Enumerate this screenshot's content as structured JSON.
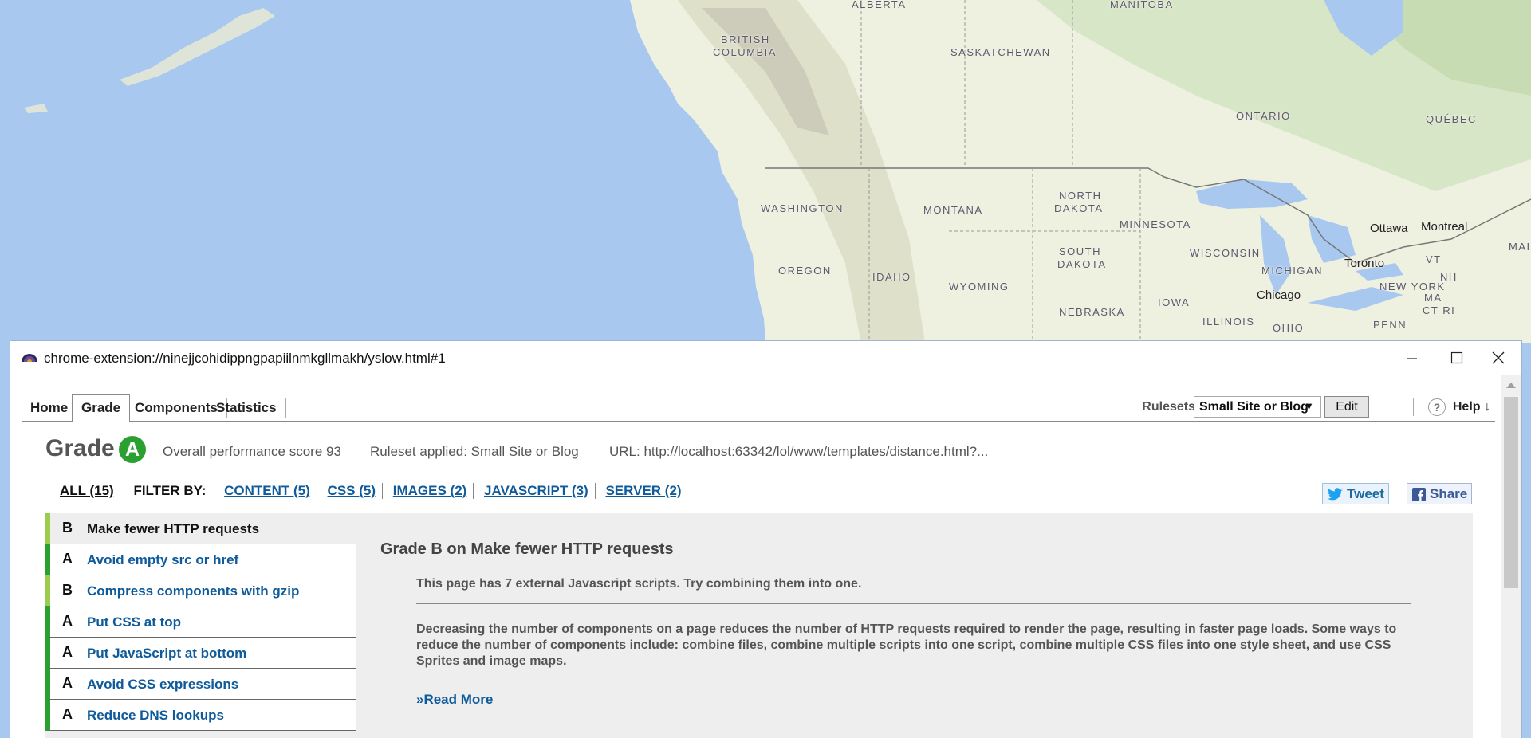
{
  "map": {
    "labels": [
      {
        "text": "ALBERTA",
        "cls": "region"
      },
      {
        "text": "MANITOBA",
        "cls": "region"
      },
      {
        "text": "BRITISH",
        "cls": "region"
      },
      {
        "text": "COLUMBIA",
        "cls": "region"
      },
      {
        "text": "SASKATCHEWAN",
        "cls": "region"
      },
      {
        "text": "ONTARIO",
        "cls": "region"
      },
      {
        "text": "QUÉBEC",
        "cls": "region"
      },
      {
        "text": "WASHINGTON",
        "cls": "region"
      },
      {
        "text": "MONTANA",
        "cls": "region"
      },
      {
        "text": "NORTH",
        "cls": "region"
      },
      {
        "text": "DAKOTA",
        "cls": "region"
      },
      {
        "text": "MINNESOTA",
        "cls": "region"
      },
      {
        "text": "Ottawa",
        "cls": "city"
      },
      {
        "text": "Montreal",
        "cls": "city"
      },
      {
        "text": "MAINE",
        "cls": "region"
      },
      {
        "text": "OREGON",
        "cls": "region"
      },
      {
        "text": "IDAHO",
        "cls": "region"
      },
      {
        "text": "SOUTH",
        "cls": "region"
      },
      {
        "text": "DAKOTA",
        "cls": "region"
      },
      {
        "text": "WISCONSIN",
        "cls": "region"
      },
      {
        "text": "MICHIGAN",
        "cls": "region"
      },
      {
        "text": "Toronto",
        "cls": "city"
      },
      {
        "text": "VT",
        "cls": "region"
      },
      {
        "text": "NH",
        "cls": "region"
      },
      {
        "text": "NEW YORK",
        "cls": "region"
      },
      {
        "text": "MA",
        "cls": "region"
      },
      {
        "text": "CT RI",
        "cls": "region"
      },
      {
        "text": "WYOMING",
        "cls": "region"
      },
      {
        "text": "Chicago",
        "cls": "city"
      },
      {
        "text": "IOWA",
        "cls": "region"
      },
      {
        "text": "NEBRASKA",
        "cls": "region"
      },
      {
        "text": "ILLINOIS",
        "cls": "region"
      },
      {
        "text": "PENN",
        "cls": "region"
      },
      {
        "text": "OHIO",
        "cls": "region"
      }
    ]
  },
  "window": {
    "title": "chrome-extension://ninejjcohidippngpapiilnmkgllmakh/yslow.html#1",
    "min_icon": "minimize-icon",
    "max_icon": "maximize-icon",
    "close_icon": "close-icon"
  },
  "tabs": [
    {
      "label": "Home",
      "active": false
    },
    {
      "label": "Grade",
      "active": true
    },
    {
      "label": "Components",
      "active": false
    },
    {
      "label": "Statistics",
      "active": false
    }
  ],
  "toolbar": {
    "rulesets_label": "Rulesets",
    "ruleset_value": "Small Site or Blog",
    "edit_label": "Edit",
    "help_q": "?",
    "help_label": "Help ↓"
  },
  "grade": {
    "word": "Grade",
    "letter": "A",
    "score_text": "Overall performance score 93",
    "ruleset_text": "Ruleset applied: Small Site or Blog",
    "url_text": "URL: http://localhost:63342/lol/www/templates/distance.html?..."
  },
  "filter": {
    "all": "ALL (15)",
    "label": "FILTER BY:",
    "links": [
      "CONTENT (5)",
      "CSS (5)",
      "IMAGES (2)",
      "JAVASCRIPT (3)",
      "SERVER (2)"
    ]
  },
  "social": {
    "tweet": "Tweet",
    "share": "Share"
  },
  "rules": [
    {
      "grade": "B",
      "name": "Make fewer HTTP requests",
      "selected": true
    },
    {
      "grade": "A",
      "name": "Avoid empty src or href",
      "selected": false
    },
    {
      "grade": "B",
      "name": "Compress components with gzip",
      "selected": false
    },
    {
      "grade": "A",
      "name": "Put CSS at top",
      "selected": false
    },
    {
      "grade": "A",
      "name": "Put JavaScript at bottom",
      "selected": false
    },
    {
      "grade": "A",
      "name": "Avoid CSS expressions",
      "selected": false
    },
    {
      "grade": "A",
      "name": "Reduce DNS lookups",
      "selected": false
    }
  ],
  "detail": {
    "title": "Grade B on Make fewer HTTP requests",
    "summary": "This page has 7 external Javascript scripts. Try combining them into one.",
    "description": "Decreasing the number of components on a page reduces the number of HTTP requests required to render the page, resulting in faster page loads. Some ways to reduce the number of components include: combine files, combine multiple scripts into one script, combine multiple CSS files into one style sheet, and use CSS Sprites and image maps.",
    "read_more": "»Read More"
  },
  "colors": {
    "grade_a": "#2aa030",
    "grade_b": "#9ccc4c",
    "link": "#0e5a9a",
    "ocean": "#a8c8f0",
    "land": "#eef0e0"
  }
}
